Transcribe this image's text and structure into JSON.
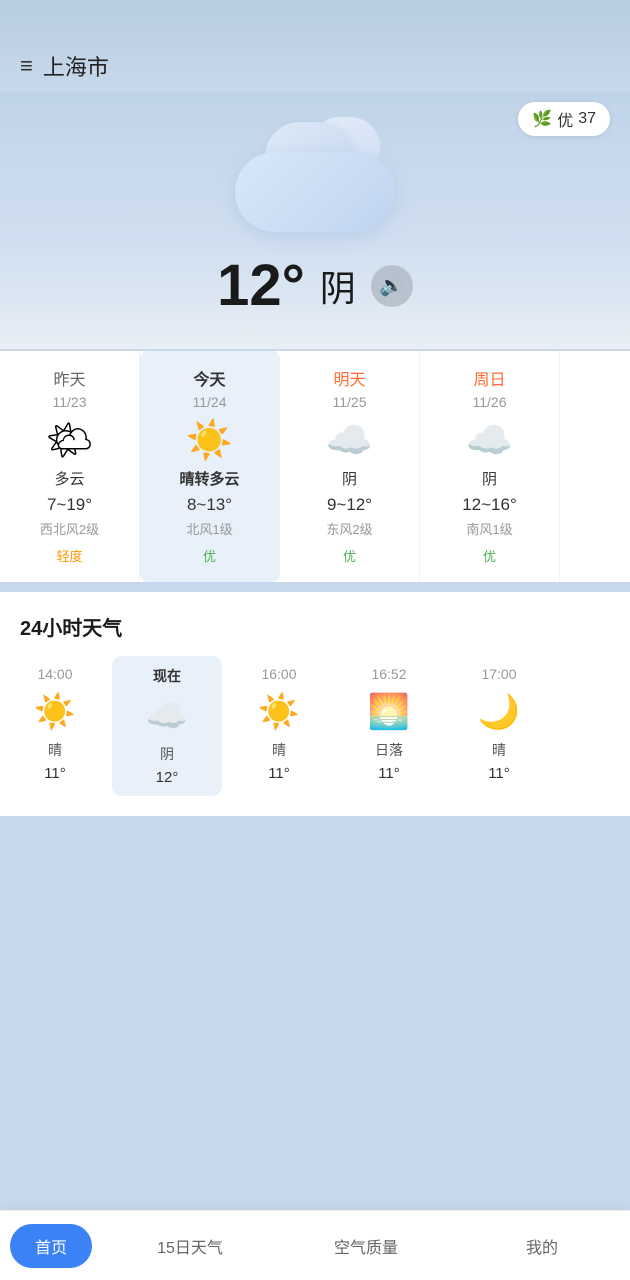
{
  "header": {
    "city": "上海市",
    "menu_icon": "≡"
  },
  "aqi": {
    "label": "优",
    "value": "37"
  },
  "current": {
    "temperature": "12°",
    "condition": "阴"
  },
  "daily": [
    {
      "label": "昨天",
      "label_class": "past",
      "date": "11/23",
      "icon": "🌤",
      "weather": "多云",
      "temp": "7~19°",
      "wind": "西北风2级",
      "aqi": "轻度",
      "aqi_class": "aqi-light"
    },
    {
      "label": "今天",
      "label_class": "today-label",
      "date": "11/24",
      "icon": "☀️",
      "weather": "晴转多云",
      "temp": "8~13°",
      "wind": "北风1级",
      "aqi": "优",
      "aqi_class": "aqi-good"
    },
    {
      "label": "明天",
      "label_class": "future",
      "date": "11/25",
      "icon": "☁️",
      "weather": "阴",
      "temp": "9~12°",
      "wind": "东风2级",
      "aqi": "优",
      "aqi_class": "aqi-good"
    },
    {
      "label": "周日",
      "label_class": "future",
      "date": "11/26",
      "icon": "☁️",
      "weather": "阴",
      "temp": "12~16°",
      "wind": "南风1级",
      "aqi": "优",
      "aqi_class": "aqi-good"
    }
  ],
  "hourly_title": "24小时天气",
  "hourly": [
    {
      "time": "14:00",
      "time_class": "",
      "icon": "☀️",
      "weather": "晴",
      "temp": "11°",
      "is_now": false
    },
    {
      "time": "现在",
      "time_class": "now-time",
      "icon": "☁️",
      "weather": "阴",
      "temp": "12°",
      "is_now": true
    },
    {
      "time": "16:00",
      "time_class": "",
      "icon": "☀️",
      "weather": "晴",
      "temp": "11°",
      "is_now": false
    },
    {
      "time": "16:52",
      "time_class": "",
      "icon": "🌅",
      "weather": "日落",
      "temp": "11°",
      "is_now": false
    },
    {
      "time": "17:00",
      "time_class": "",
      "icon": "🌙",
      "weather": "晴",
      "temp": "11°",
      "is_now": false
    }
  ],
  "nav": {
    "items": [
      {
        "label": "首页",
        "active": true
      },
      {
        "label": "15日天气",
        "active": false
      },
      {
        "label": "空气质量",
        "active": false
      },
      {
        "label": "我的",
        "active": false
      }
    ]
  }
}
